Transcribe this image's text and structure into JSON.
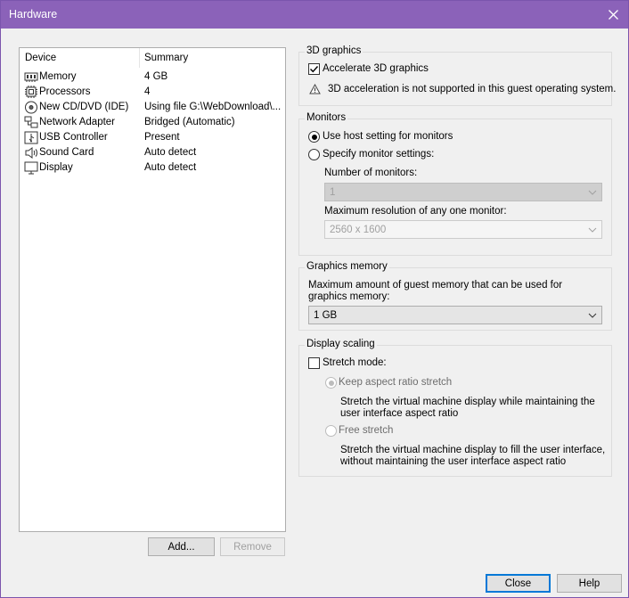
{
  "window": {
    "title": "Hardware"
  },
  "device_list": {
    "columns": {
      "device": "Device",
      "summary": "Summary"
    },
    "rows": [
      {
        "icon": "memory-icon",
        "name": "Memory",
        "summary": "4 GB"
      },
      {
        "icon": "processor-icon",
        "name": "Processors",
        "summary": "4"
      },
      {
        "icon": "cd-dvd-icon",
        "name": "New CD/DVD (IDE)",
        "summary": "Using file G:\\WebDownload\\..."
      },
      {
        "icon": "network-adapter-icon",
        "name": "Network Adapter",
        "summary": "Bridged (Automatic)"
      },
      {
        "icon": "usb-controller-icon",
        "name": "USB Controller",
        "summary": "Present"
      },
      {
        "icon": "sound-card-icon",
        "name": "Sound Card",
        "summary": "Auto detect"
      },
      {
        "icon": "display-icon",
        "name": "Display",
        "summary": "Auto detect"
      }
    ],
    "add_label": "Add...",
    "remove_label": "Remove"
  },
  "graphics_3d": {
    "title": "3D graphics",
    "accelerate_label": "Accelerate 3D graphics",
    "accelerate_checked": true,
    "warning_text": "3D acceleration is not supported in this guest operating system."
  },
  "monitors": {
    "title": "Monitors",
    "use_host_label": "Use host setting for monitors",
    "specify_label": "Specify monitor settings:",
    "selected": "use_host",
    "number_label": "Number of monitors:",
    "number_value": "1",
    "max_res_label": "Maximum resolution of any one monitor:",
    "max_res_value": "2560 x 1600"
  },
  "graphics_memory": {
    "title": "Graphics memory",
    "description": "Maximum amount of guest memory that can be used for graphics memory:",
    "value": "1 GB"
  },
  "display_scaling": {
    "title": "Display scaling",
    "stretch_label": "Stretch mode:",
    "stretch_checked": false,
    "keep_aspect_label": "Keep aspect ratio stretch",
    "keep_aspect_desc": "Stretch the virtual machine display while maintaining the user interface aspect ratio",
    "free_stretch_label": "Free stretch",
    "free_stretch_desc": "Stretch the virtual machine display to fill the user interface, without maintaining the user interface aspect ratio"
  },
  "footer": {
    "close_label": "Close",
    "help_label": "Help"
  }
}
